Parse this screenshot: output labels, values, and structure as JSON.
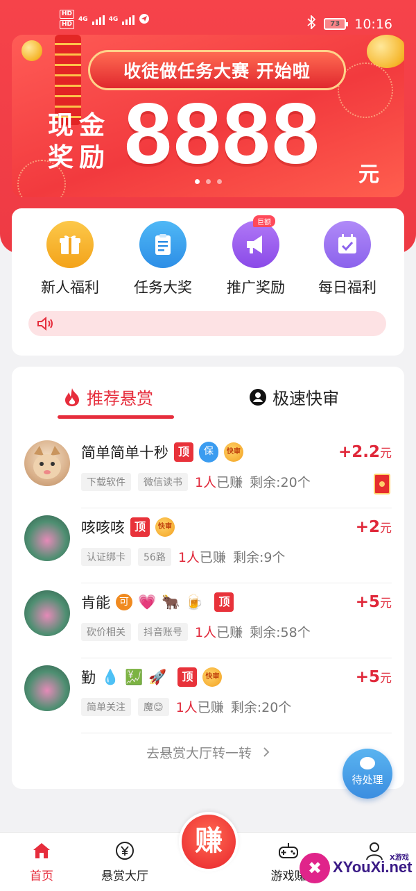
{
  "status_bar": {
    "hd_1": "HD",
    "hd_2": "HD",
    "net_1": "4G",
    "net_2": "4G",
    "battery": "73",
    "time": "10:16"
  },
  "banner": {
    "headline": "收徒做任务大赛 开始啦",
    "cash_label": "现金奖励",
    "amount": "8888",
    "unit": "元",
    "page_count": 3,
    "active_page": 0
  },
  "quick_menu": {
    "items": [
      {
        "label": "新人福利",
        "icon": "gift-icon",
        "color": "#f7b928"
      },
      {
        "label": "任务大奖",
        "icon": "clipboard-icon",
        "color": "#3aa6f2"
      },
      {
        "label": "推广奖励",
        "icon": "megaphone-icon",
        "color": "#a05ef0",
        "badge": "巨额"
      },
      {
        "label": "每日福利",
        "icon": "calendar-check-icon",
        "color": "#9b6cf2"
      }
    ],
    "notice_icon": "speaker-icon"
  },
  "tabs": {
    "recommended": "推荐悬赏",
    "fast_review": "极速快审",
    "active": "recommended"
  },
  "rewards": [
    {
      "title": "简单简单十秒",
      "tags": [
        "顶",
        "保",
        "快审"
      ],
      "reward": "+2.2",
      "unit": "元",
      "chips": [
        "下载软件",
        "微信读书"
      ],
      "earned_count": "1人",
      "earned_label": "已赚",
      "remaining": "剩余:20个",
      "red_packet": true,
      "avatar": "cat-photo"
    },
    {
      "title": "咳咳咳",
      "tags": [
        "顶",
        "快审"
      ],
      "reward": "+2",
      "unit": "元",
      "chips": [
        "认证绑卡",
        "56路"
      ],
      "earned_count": "1人",
      "earned_label": "已赚",
      "remaining": "剩余:9个",
      "avatar": "flower-photo"
    },
    {
      "title": "肯能",
      "emojis": [
        "可",
        "💗",
        "🐂",
        "🍺"
      ],
      "tags": [
        "顶"
      ],
      "reward": "+5",
      "unit": "元",
      "chips": [
        "砍价相关",
        "抖音账号"
      ],
      "earned_count": "1人",
      "earned_label": "已赚",
      "remaining": "剩余:58个",
      "avatar": "flower-photo"
    },
    {
      "title": "勤",
      "emojis": [
        "💧",
        "💹",
        "🚀"
      ],
      "tags": [
        "顶",
        "快审"
      ],
      "reward": "+5",
      "unit": "元",
      "chips": [
        "简单关注",
        "魔😊"
      ],
      "earned_count": "1人",
      "earned_label": "已赚",
      "remaining": "剩余:20个",
      "avatar": "flower-photo"
    }
  ],
  "more_link": "去悬赏大厅转一转",
  "float_button": "待处理",
  "bottom_nav": {
    "home": "首页",
    "hall": "悬赏大厅",
    "earn": "赚",
    "games": "游戏赚",
    "me": ""
  },
  "watermark": {
    "text": "XYouXi.net",
    "small": "X游戏"
  },
  "colors": {
    "brand_red": "#ee3a44",
    "reward_red": "#e0283a",
    "accent_blue": "#3b8de0"
  }
}
